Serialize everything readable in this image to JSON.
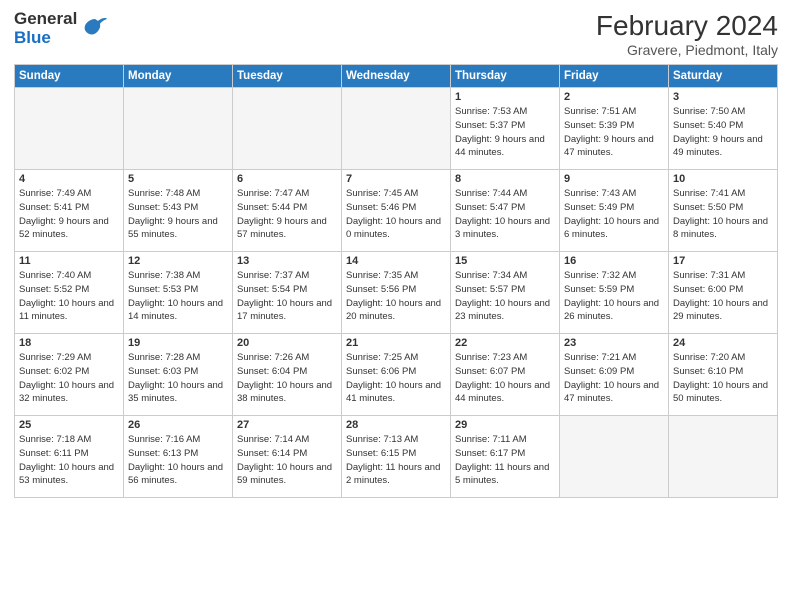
{
  "header": {
    "logo_line1": "General",
    "logo_line2": "Blue",
    "month_year": "February 2024",
    "location": "Gravere, Piedmont, Italy"
  },
  "days_of_week": [
    "Sunday",
    "Monday",
    "Tuesday",
    "Wednesday",
    "Thursday",
    "Friday",
    "Saturday"
  ],
  "weeks": [
    [
      {
        "day": "",
        "info": ""
      },
      {
        "day": "",
        "info": ""
      },
      {
        "day": "",
        "info": ""
      },
      {
        "day": "",
        "info": ""
      },
      {
        "day": "1",
        "info": "Sunrise: 7:53 AM\nSunset: 5:37 PM\nDaylight: 9 hours and 44 minutes."
      },
      {
        "day": "2",
        "info": "Sunrise: 7:51 AM\nSunset: 5:39 PM\nDaylight: 9 hours and 47 minutes."
      },
      {
        "day": "3",
        "info": "Sunrise: 7:50 AM\nSunset: 5:40 PM\nDaylight: 9 hours and 49 minutes."
      }
    ],
    [
      {
        "day": "4",
        "info": "Sunrise: 7:49 AM\nSunset: 5:41 PM\nDaylight: 9 hours and 52 minutes."
      },
      {
        "day": "5",
        "info": "Sunrise: 7:48 AM\nSunset: 5:43 PM\nDaylight: 9 hours and 55 minutes."
      },
      {
        "day": "6",
        "info": "Sunrise: 7:47 AM\nSunset: 5:44 PM\nDaylight: 9 hours and 57 minutes."
      },
      {
        "day": "7",
        "info": "Sunrise: 7:45 AM\nSunset: 5:46 PM\nDaylight: 10 hours and 0 minutes."
      },
      {
        "day": "8",
        "info": "Sunrise: 7:44 AM\nSunset: 5:47 PM\nDaylight: 10 hours and 3 minutes."
      },
      {
        "day": "9",
        "info": "Sunrise: 7:43 AM\nSunset: 5:49 PM\nDaylight: 10 hours and 6 minutes."
      },
      {
        "day": "10",
        "info": "Sunrise: 7:41 AM\nSunset: 5:50 PM\nDaylight: 10 hours and 8 minutes."
      }
    ],
    [
      {
        "day": "11",
        "info": "Sunrise: 7:40 AM\nSunset: 5:52 PM\nDaylight: 10 hours and 11 minutes."
      },
      {
        "day": "12",
        "info": "Sunrise: 7:38 AM\nSunset: 5:53 PM\nDaylight: 10 hours and 14 minutes."
      },
      {
        "day": "13",
        "info": "Sunrise: 7:37 AM\nSunset: 5:54 PM\nDaylight: 10 hours and 17 minutes."
      },
      {
        "day": "14",
        "info": "Sunrise: 7:35 AM\nSunset: 5:56 PM\nDaylight: 10 hours and 20 minutes."
      },
      {
        "day": "15",
        "info": "Sunrise: 7:34 AM\nSunset: 5:57 PM\nDaylight: 10 hours and 23 minutes."
      },
      {
        "day": "16",
        "info": "Sunrise: 7:32 AM\nSunset: 5:59 PM\nDaylight: 10 hours and 26 minutes."
      },
      {
        "day": "17",
        "info": "Sunrise: 7:31 AM\nSunset: 6:00 PM\nDaylight: 10 hours and 29 minutes."
      }
    ],
    [
      {
        "day": "18",
        "info": "Sunrise: 7:29 AM\nSunset: 6:02 PM\nDaylight: 10 hours and 32 minutes."
      },
      {
        "day": "19",
        "info": "Sunrise: 7:28 AM\nSunset: 6:03 PM\nDaylight: 10 hours and 35 minutes."
      },
      {
        "day": "20",
        "info": "Sunrise: 7:26 AM\nSunset: 6:04 PM\nDaylight: 10 hours and 38 minutes."
      },
      {
        "day": "21",
        "info": "Sunrise: 7:25 AM\nSunset: 6:06 PM\nDaylight: 10 hours and 41 minutes."
      },
      {
        "day": "22",
        "info": "Sunrise: 7:23 AM\nSunset: 6:07 PM\nDaylight: 10 hours and 44 minutes."
      },
      {
        "day": "23",
        "info": "Sunrise: 7:21 AM\nSunset: 6:09 PM\nDaylight: 10 hours and 47 minutes."
      },
      {
        "day": "24",
        "info": "Sunrise: 7:20 AM\nSunset: 6:10 PM\nDaylight: 10 hours and 50 minutes."
      }
    ],
    [
      {
        "day": "25",
        "info": "Sunrise: 7:18 AM\nSunset: 6:11 PM\nDaylight: 10 hours and 53 minutes."
      },
      {
        "day": "26",
        "info": "Sunrise: 7:16 AM\nSunset: 6:13 PM\nDaylight: 10 hours and 56 minutes."
      },
      {
        "day": "27",
        "info": "Sunrise: 7:14 AM\nSunset: 6:14 PM\nDaylight: 10 hours and 59 minutes."
      },
      {
        "day": "28",
        "info": "Sunrise: 7:13 AM\nSunset: 6:15 PM\nDaylight: 11 hours and 2 minutes."
      },
      {
        "day": "29",
        "info": "Sunrise: 7:11 AM\nSunset: 6:17 PM\nDaylight: 11 hours and 5 minutes."
      },
      {
        "day": "",
        "info": ""
      },
      {
        "day": "",
        "info": ""
      }
    ]
  ]
}
